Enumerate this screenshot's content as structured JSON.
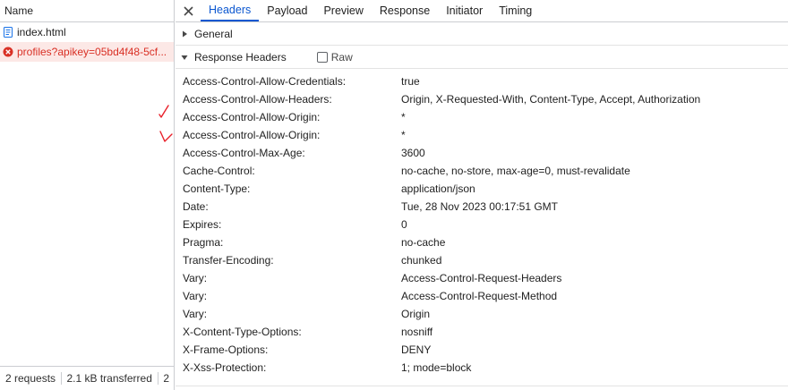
{
  "request_list": {
    "header": "Name",
    "items": [
      {
        "name": "index.html",
        "type": "document",
        "error": false
      },
      {
        "name": "profiles?apikey=05bd4f48-5cf...",
        "type": "error",
        "error": true
      }
    ]
  },
  "status_bar": {
    "requests": "2 requests",
    "transferred": "2.1 kB transferred",
    "more": "2"
  },
  "tabs": [
    {
      "label": "Headers",
      "active": true
    },
    {
      "label": "Payload",
      "active": false
    },
    {
      "label": "Preview",
      "active": false
    },
    {
      "label": "Response",
      "active": false
    },
    {
      "label": "Initiator",
      "active": false
    },
    {
      "label": "Timing",
      "active": false
    }
  ],
  "sections": {
    "general": {
      "label": "General",
      "expanded": false
    },
    "response_headers": {
      "label": "Response Headers",
      "expanded": true,
      "raw_label": "Raw",
      "raw_checked": false
    }
  },
  "response_headers": [
    {
      "name": "Access-Control-Allow-Credentials:",
      "value": "true"
    },
    {
      "name": "Access-Control-Allow-Headers:",
      "value": "Origin, X-Requested-With, Content-Type, Accept, Authorization"
    },
    {
      "name": "Access-Control-Allow-Origin:",
      "value": "*"
    },
    {
      "name": "Access-Control-Allow-Origin:",
      "value": "*"
    },
    {
      "name": "Access-Control-Max-Age:",
      "value": "3600"
    },
    {
      "name": "Cache-Control:",
      "value": "no-cache, no-store, max-age=0, must-revalidate"
    },
    {
      "name": "Content-Type:",
      "value": "application/json"
    },
    {
      "name": "Date:",
      "value": "Tue, 28 Nov 2023 00:17:51 GMT"
    },
    {
      "name": "Expires:",
      "value": "0"
    },
    {
      "name": "Pragma:",
      "value": "no-cache"
    },
    {
      "name": "Transfer-Encoding:",
      "value": "chunked"
    },
    {
      "name": "Vary:",
      "value": "Access-Control-Request-Headers"
    },
    {
      "name": "Vary:",
      "value": "Access-Control-Request-Method"
    },
    {
      "name": "Vary:",
      "value": "Origin"
    },
    {
      "name": "X-Content-Type-Options:",
      "value": "nosniff"
    },
    {
      "name": "X-Frame-Options:",
      "value": "DENY"
    },
    {
      "name": "X-Xss-Protection:",
      "value": "1; mode=block"
    }
  ],
  "colors": {
    "accent": "#0b57d0",
    "error": "#d93025",
    "error_row_bg": "#fce8e6",
    "annotation": "#e8202a"
  },
  "icons": {
    "document": "document-icon",
    "error": "error-icon",
    "close": "close-icon",
    "collapsed": "triangle-right-icon",
    "expanded": "triangle-down-icon"
  }
}
